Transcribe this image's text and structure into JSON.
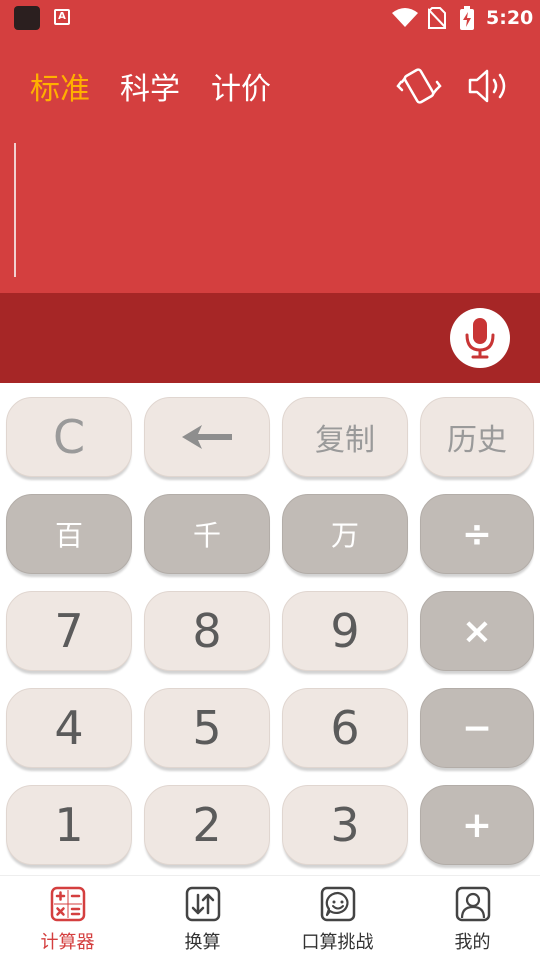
{
  "status_bar": {
    "time": "5:20",
    "a_glyph": "A"
  },
  "tabs": [
    {
      "label": "标准",
      "active": true
    },
    {
      "label": "科学",
      "active": false
    },
    {
      "label": "计价",
      "active": false
    }
  ],
  "header_icons": {
    "vibrate": "vibrate-phone-icon",
    "sound": "speaker-icon"
  },
  "display": {
    "expression": ""
  },
  "mic": {
    "icon": "microphone-icon"
  },
  "keys": {
    "clear": "C",
    "backspace_icon": "back-arrow-icon",
    "copy": "复制",
    "history": "历史",
    "hundred": "百",
    "thousand": "千",
    "ten_thousand": "万",
    "divide": "÷",
    "seven": "7",
    "eight": "8",
    "nine": "9",
    "multiply": "×",
    "four": "4",
    "five": "5",
    "six": "6",
    "minus": "−",
    "one": "1",
    "two": "2",
    "three": "3",
    "plus": "+"
  },
  "bottom_nav": [
    {
      "label": "计算器",
      "active": true,
      "icon": "calculator-icon"
    },
    {
      "label": "换算",
      "active": false,
      "icon": "convert-arrows-icon"
    },
    {
      "label": "口算挑战",
      "active": false,
      "icon": "chat-smile-icon"
    },
    {
      "label": "我的",
      "active": false,
      "icon": "profile-icon"
    }
  ],
  "colors": {
    "primary_red": "#d43f3f",
    "dark_red": "#a62626",
    "active_tab": "#ffb000",
    "key_light": "#efe7e2",
    "key_dark": "#c1bbb6"
  }
}
